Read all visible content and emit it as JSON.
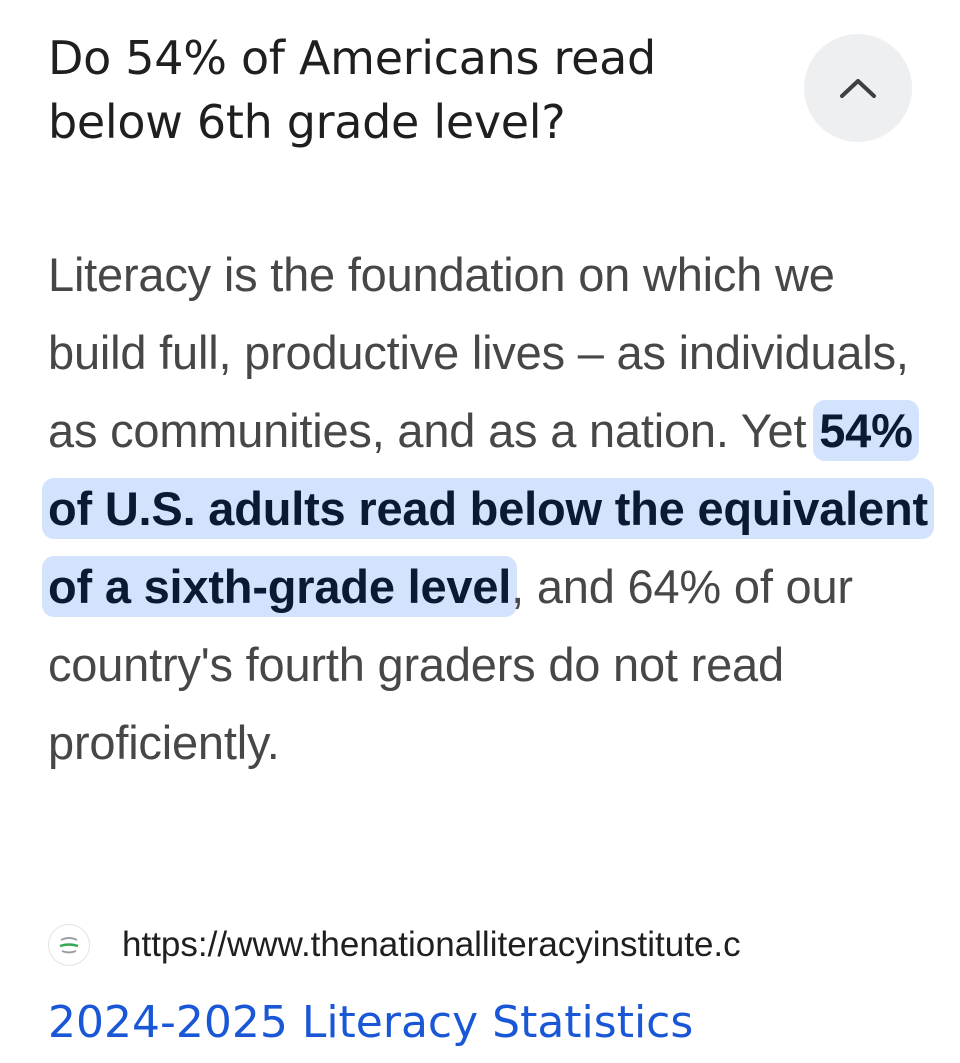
{
  "faq": {
    "question": "Do 54% of Americans read below 6th grade level?",
    "collapse_icon": "chevron-up-icon",
    "answer": {
      "before": "Literacy is the foundation on which we build full, productive lives – as individuals, as communities, and as a nation. Yet ",
      "highlight": "54% of U.S. adults read below the equivalent of a sixth-grade level",
      "after": ", and 64% of our country's fourth graders do not read proficiently."
    },
    "source": {
      "favicon": "site-favicon-icon",
      "url": "https://www.thenationalliteracyinstitute.c"
    },
    "result_title": "2024-2025 Literacy Statistics"
  },
  "colors": {
    "highlight_bg": "#d3e3fd",
    "link": "#1a57d6",
    "body_text": "#474747",
    "title_text": "#1f1f1f",
    "button_bg": "#eeeff1"
  }
}
